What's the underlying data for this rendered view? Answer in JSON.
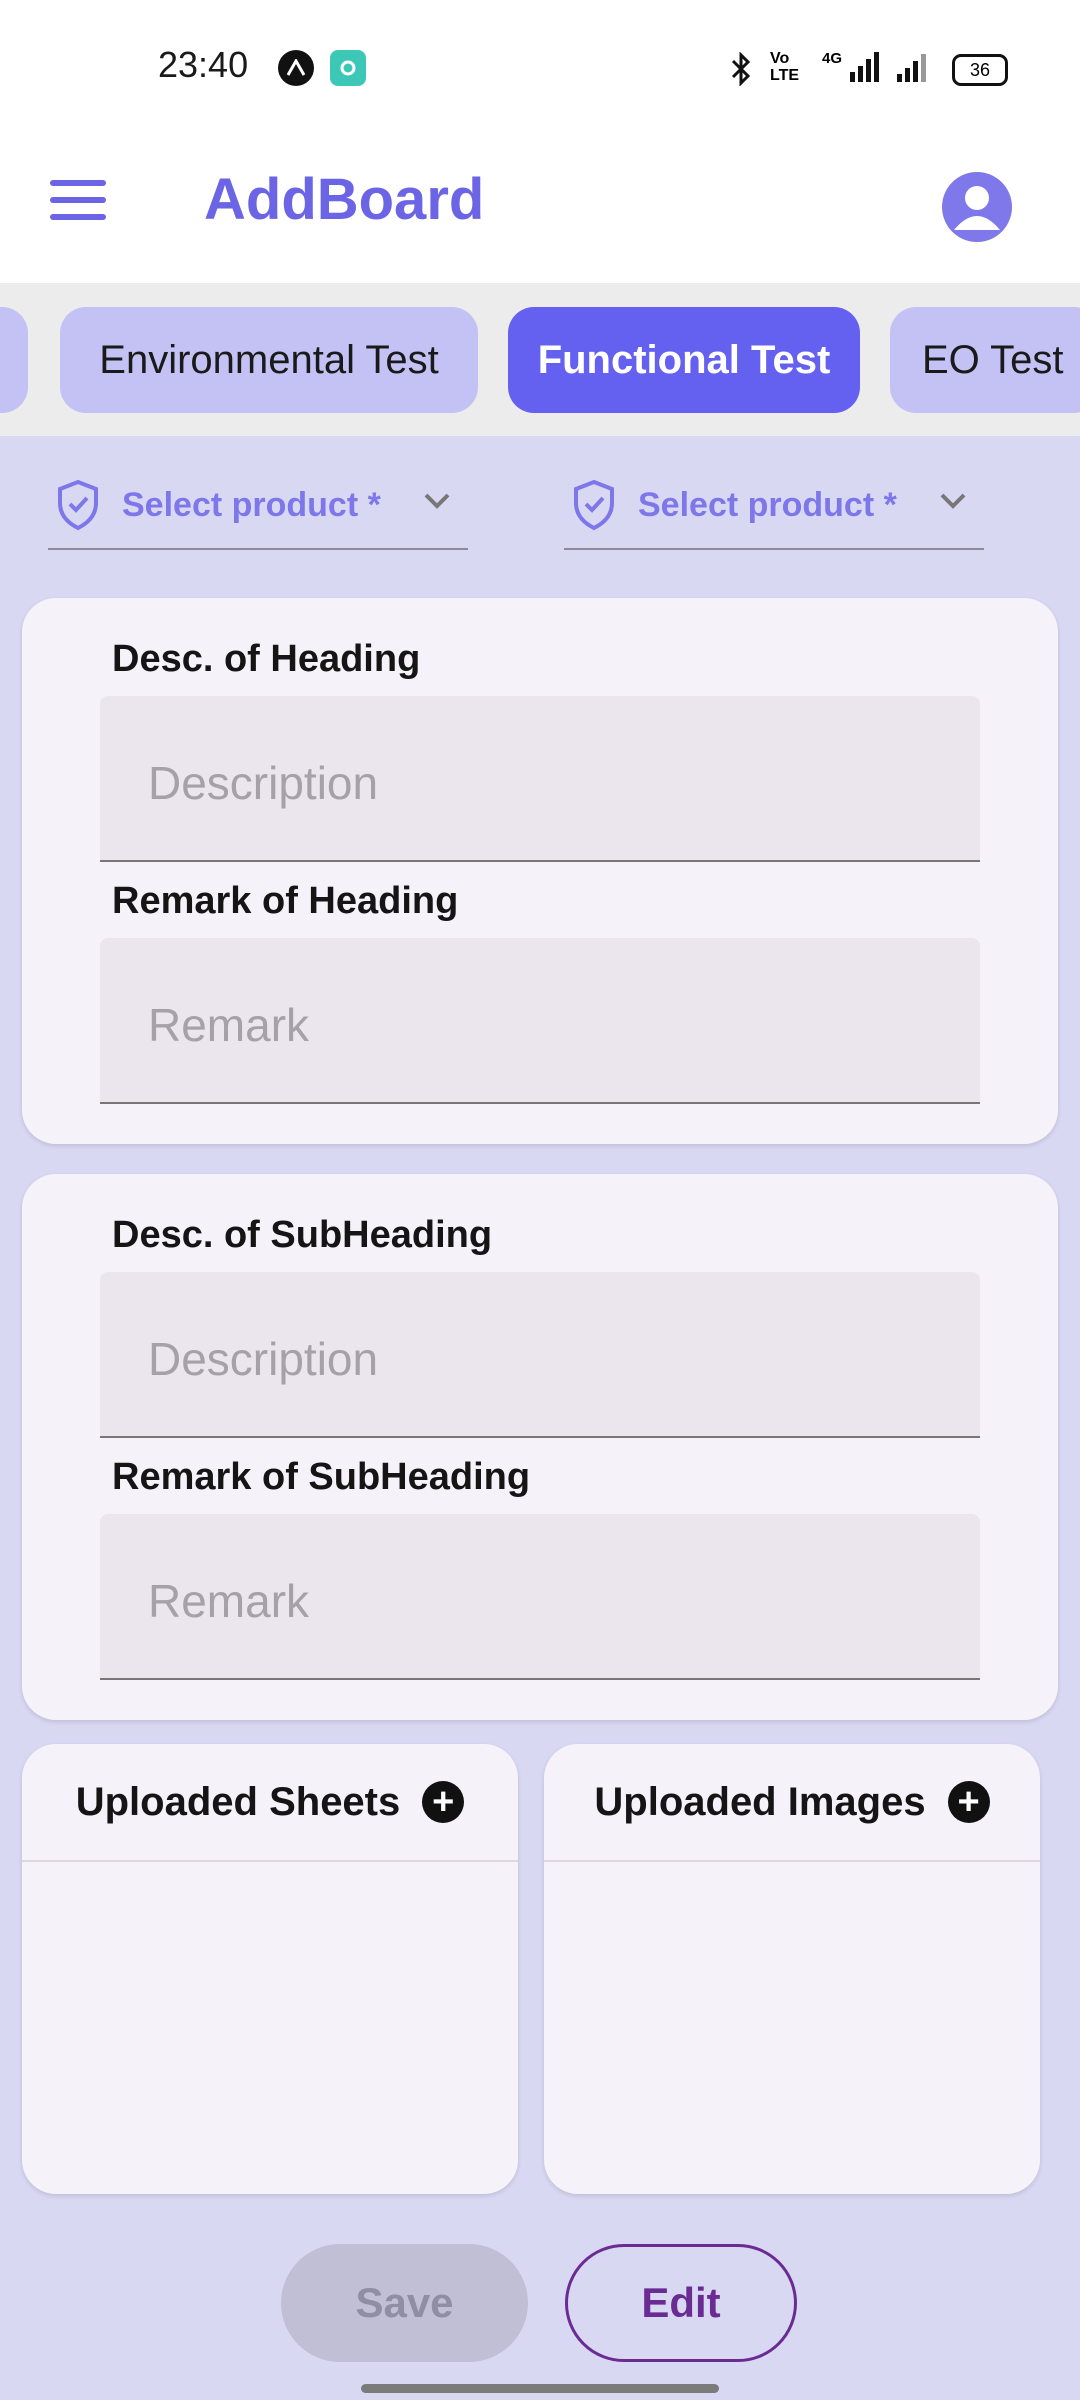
{
  "status_bar": {
    "time": "23:40",
    "network": "4G",
    "volte": "Vo LTE",
    "battery": "36"
  },
  "app_bar": {
    "title": "AddBoard"
  },
  "tabs": [
    {
      "label": ""
    },
    {
      "label": "Environmental Test"
    },
    {
      "label": "Functional Test"
    },
    {
      "label": "EO Test"
    }
  ],
  "selectors": [
    {
      "label": "Select product *"
    },
    {
      "label": "Select product *"
    }
  ],
  "heading_card": {
    "desc_label": "Desc. of Heading",
    "desc_placeholder": "Description",
    "remark_label": "Remark of Heading",
    "remark_placeholder": "Remark"
  },
  "subheading_card": {
    "desc_label": "Desc. of SubHeading",
    "desc_placeholder": "Description",
    "remark_label": "Remark of SubHeading",
    "remark_placeholder": "Remark"
  },
  "uploads": {
    "sheets_title": "Uploaded Sheets",
    "images_title": "Uploaded Images"
  },
  "actions": {
    "save_label": "Save",
    "edit_label": "Edit"
  },
  "colors": {
    "accent": "#6561f0",
    "title": "#6b65e6",
    "background": "#d9d8f3"
  }
}
